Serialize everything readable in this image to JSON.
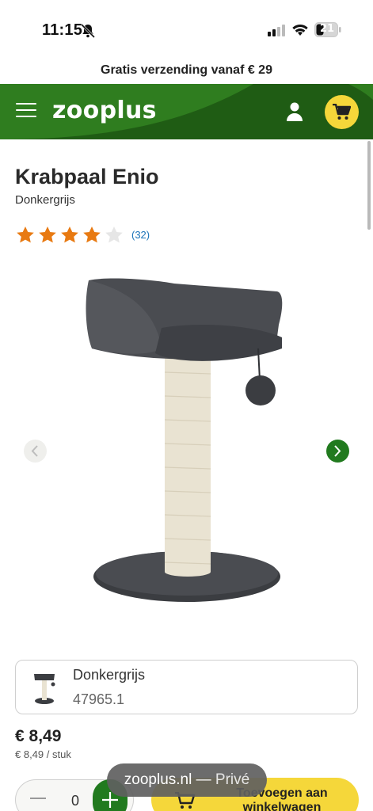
{
  "status_bar": {
    "time": "11:15",
    "battery": "21"
  },
  "promo": {
    "text": "Gratis verzending vanaf € 29"
  },
  "header": {
    "logo": "zooplus"
  },
  "product": {
    "title": "Krabpaal Enio",
    "subtitle": "Donkergrijs",
    "rating": 4,
    "rating_max": 5,
    "review_count": "(32)"
  },
  "variant": {
    "name": "Donkergrijs",
    "sku": "47965.1"
  },
  "price": {
    "value": "€ 8,49",
    "unit": "€ 8,49 / stuk"
  },
  "quantity": {
    "value": "0"
  },
  "cart": {
    "button_label": "In winkelwagen / Toevoegen aan winkelwagen",
    "label_line1": "Toevoegen aan",
    "label_line2": "winkelwagen"
  },
  "browser": {
    "host": "zooplus.nl",
    "separator": "—",
    "mode": "Privé"
  },
  "colors": {
    "brand_green": "#1f5c14",
    "accent_yellow": "#f5d73a",
    "star_orange": "#e87a12",
    "link_blue": "#1a73b8"
  },
  "icons": [
    "bell-muted-icon",
    "signal-icon",
    "wifi-icon",
    "battery-icon",
    "menu-icon",
    "user-icon",
    "cart-icon",
    "star-icon",
    "chevron-left-icon",
    "chevron-right-icon",
    "plus-icon",
    "minus-icon"
  ]
}
